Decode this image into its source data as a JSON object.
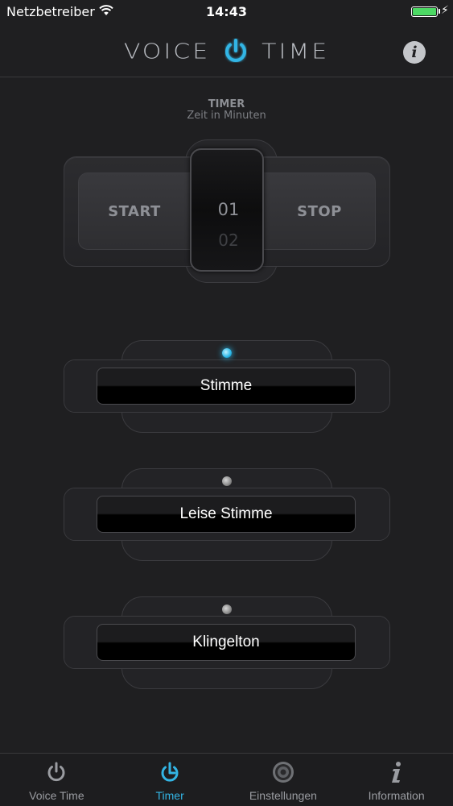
{
  "status_bar": {
    "carrier": "Netzbetreiber",
    "time": "14:43",
    "battery_color": "#4cd964"
  },
  "header": {
    "logo_word_left": "VOICE",
    "logo_word_right": "TIME",
    "logo_icon": "power-icon",
    "info_glyph": "i",
    "accent_color": "#33b5e5"
  },
  "timer": {
    "title": "TIMER",
    "subtitle": "Zeit in Minuten",
    "start_label": "START",
    "stop_label": "STOP",
    "picker_selected": "01",
    "picker_next": "02"
  },
  "modes": [
    {
      "label": "Stimme",
      "active": true
    },
    {
      "label": "Leise Stimme",
      "active": false
    },
    {
      "label": "Klingelton",
      "active": false
    }
  ],
  "tabs": [
    {
      "label": "Voice Time",
      "icon": "power-icon",
      "active": false
    },
    {
      "label": "Timer",
      "icon": "timer-icon",
      "active": true
    },
    {
      "label": "Einstellungen",
      "icon": "speaker-icon",
      "active": false
    },
    {
      "label": "Information",
      "icon": "info-icon",
      "active": false
    }
  ]
}
